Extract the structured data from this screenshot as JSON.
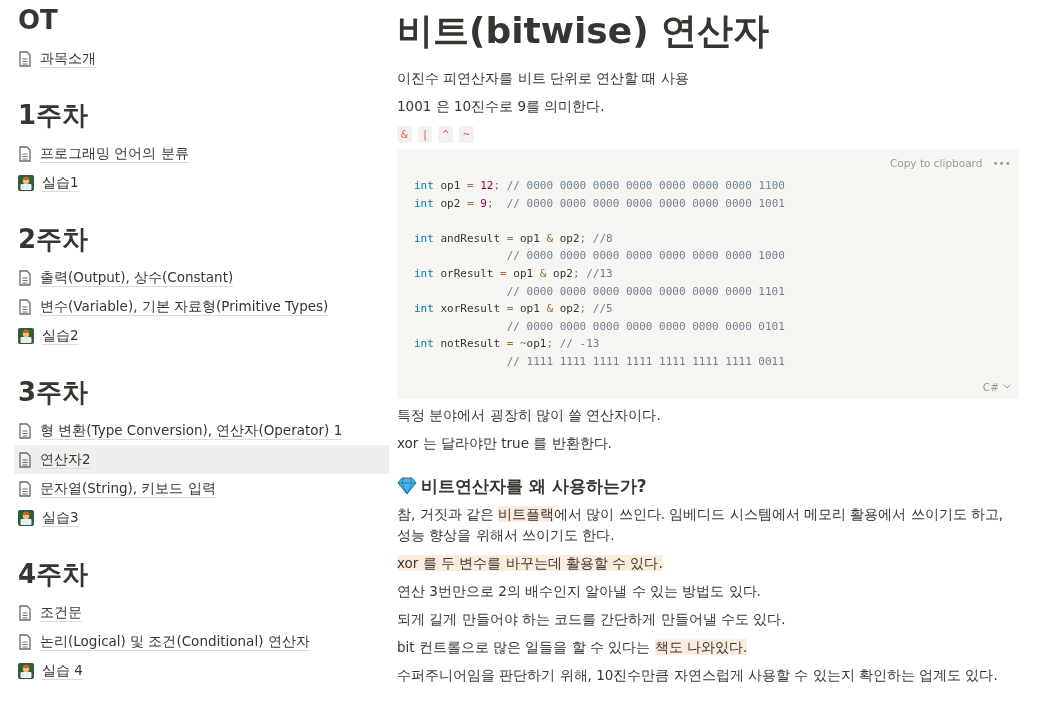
{
  "sidebar": {
    "sections": [
      {
        "heading": "OT",
        "items": [
          {
            "label": "과목소개",
            "kind": "page",
            "selected": false
          }
        ]
      },
      {
        "heading": "1주차",
        "items": [
          {
            "label": "프로그래밍 언어의 분류",
            "kind": "page",
            "selected": false
          },
          {
            "label": "실습1",
            "kind": "emoji",
            "selected": false
          }
        ]
      },
      {
        "heading": "2주차",
        "items": [
          {
            "label": "출력(Output), 상수(Constant)",
            "kind": "page",
            "selected": false
          },
          {
            "label": "변수(Variable), 기본 자료형(Primitive Types)",
            "kind": "page",
            "selected": false
          },
          {
            "label": "실습2",
            "kind": "emoji",
            "selected": false
          }
        ]
      },
      {
        "heading": "3주차",
        "items": [
          {
            "label": "형 변환(Type Conversion), 연산자(Operator) 1",
            "kind": "page",
            "selected": false
          },
          {
            "label": "연산자2",
            "kind": "page",
            "selected": true
          },
          {
            "label": "문자열(String), 키보드 입력",
            "kind": "page",
            "selected": false
          },
          {
            "label": "실습3",
            "kind": "emoji",
            "selected": false
          }
        ]
      },
      {
        "heading": "4주차",
        "items": [
          {
            "label": "조건문",
            "kind": "page",
            "selected": false
          },
          {
            "label": "논리(Logical) 및 조건(Conditional) 연산자",
            "kind": "page",
            "selected": false
          },
          {
            "label": "실습 4",
            "kind": "emoji",
            "selected": false
          }
        ]
      }
    ]
  },
  "page": {
    "title": "비트(bitwise) 연산자",
    "intro": [
      "이진수 피연산자를 비트 단위로 연산할 때 사용",
      "1001 은 10진수로 9를 의미한다."
    ],
    "operators": [
      "&",
      "|",
      "^",
      "~"
    ],
    "code_block": {
      "copy_label": "Copy to clipboard",
      "more": "•••",
      "language": "C#",
      "lines": [
        [
          {
            "kind": "keyword",
            "text": "int"
          },
          {
            "kind": "plain",
            "text": " op1 "
          },
          {
            "kind": "operator",
            "text": "="
          },
          {
            "kind": "number",
            "text": " 12"
          },
          {
            "kind": "comment",
            "text": "; // 0000 0000 0000 0000 0000 0000 0000 1100"
          }
        ],
        [
          {
            "kind": "keyword",
            "text": "int"
          },
          {
            "kind": "plain",
            "text": " op2 "
          },
          {
            "kind": "operator",
            "text": "="
          },
          {
            "kind": "number",
            "text": " 9"
          },
          {
            "kind": "comment",
            "text": ";  // 0000 0000 0000 0000 0000 0000 0000 1001"
          }
        ],
        [
          {
            "kind": "blank"
          }
        ],
        [
          {
            "kind": "keyword",
            "text": "int"
          },
          {
            "kind": "plain",
            "text": " andResult "
          },
          {
            "kind": "operator",
            "text": "="
          },
          {
            "kind": "plain",
            "text": " op1 "
          },
          {
            "kind": "operator",
            "text": "&"
          },
          {
            "kind": "plain",
            "text": " op2"
          },
          {
            "kind": "comment",
            "text": "; //8"
          }
        ],
        [
          {
            "kind": "comment",
            "text": "              // 0000 0000 0000 0000 0000 0000 0000 1000"
          }
        ],
        [
          {
            "kind": "keyword",
            "text": "int"
          },
          {
            "kind": "plain",
            "text": " orResult "
          },
          {
            "kind": "operator",
            "text": "="
          },
          {
            "kind": "plain",
            "text": " op1 "
          },
          {
            "kind": "operator",
            "text": "&"
          },
          {
            "kind": "plain",
            "text": " op2"
          },
          {
            "kind": "comment",
            "text": "; //13"
          }
        ],
        [
          {
            "kind": "comment",
            "text": "              // 0000 0000 0000 0000 0000 0000 0000 1101"
          }
        ],
        [
          {
            "kind": "keyword",
            "text": "int"
          },
          {
            "kind": "plain",
            "text": " xorResult "
          },
          {
            "kind": "operator",
            "text": "="
          },
          {
            "kind": "plain",
            "text": " op1 "
          },
          {
            "kind": "operator",
            "text": "&"
          },
          {
            "kind": "plain",
            "text": " op2"
          },
          {
            "kind": "comment",
            "text": "; //5"
          }
        ],
        [
          {
            "kind": "comment",
            "text": "              // 0000 0000 0000 0000 0000 0000 0000 0101"
          }
        ],
        [
          {
            "kind": "keyword",
            "text": "int"
          },
          {
            "kind": "plain",
            "text": " notResult "
          },
          {
            "kind": "operator",
            "text": "= ~"
          },
          {
            "kind": "plain",
            "text": "op1"
          },
          {
            "kind": "comment",
            "text": "; // -13"
          }
        ],
        [
          {
            "kind": "comment",
            "text": "              // 1111 1111 1111 1111 1111 1111 1111 0011"
          }
        ]
      ]
    },
    "after_code": [
      "특정 분야에서 굉장히 많이 쓸 연산자이다.",
      "xor 는 달라야만 true 를 반환한다."
    ],
    "callout_heading": "비트연산자를 왜 사용하는가?",
    "paragraphs": [
      [
        {
          "text": "참, 거짓과 같은 ",
          "highlight": false
        },
        {
          "text": "비트플랙",
          "highlight": true
        },
        {
          "text": "에서 많이 쓰인다. 임베디드 시스템에서 메모리 활용에서 쓰이기도 하고, 성능 향상을 위해서 쓰이기도 한다.",
          "highlight": false
        }
      ],
      [
        {
          "text": "xor 를 두 변수를 바꾸는데 활용할 수 있다.",
          "highlight": true
        }
      ],
      [
        {
          "text": "연산 3번만으로 2의 배수인지 알아낼 수 있는 방법도 있다.",
          "highlight": false
        }
      ],
      [
        {
          "text": "되게 길게 만들어야 하는 코드를 간단하게 만들어낼 수도 있다.",
          "highlight": false
        }
      ],
      [
        {
          "text": "bit 컨트롤으로 많은 일들을 할 수 있다는 ",
          "highlight": false
        },
        {
          "text": "책도 나와있다.",
          "highlight": true
        }
      ],
      [
        {
          "text": "수퍼주니어임을 판단하기 위해, 10진수만큼 자연스럽게 사용할 수 있는지 확인하는 업계도 있다.",
          "highlight": false
        }
      ]
    ]
  }
}
